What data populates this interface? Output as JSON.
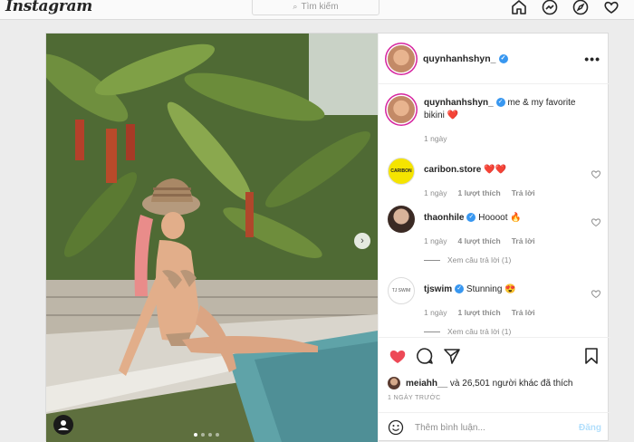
{
  "app": {
    "logo": "Instagram",
    "search_placeholder": "Tìm kiếm"
  },
  "post": {
    "author": "quynhanhshyn_",
    "caption": "me & my favorite bikini",
    "caption_emoji": "❤️",
    "caption_time": "1 ngày",
    "image_dots": 4,
    "active_dot": 0
  },
  "comments": [
    {
      "user": "caribon.store",
      "text": "❤️❤️",
      "verified": false,
      "time": "1 ngày",
      "likes": "1 lượt thích",
      "reply": "Trả lời",
      "view_replies": null
    },
    {
      "user": "thaonhile",
      "text": "Hoooot 🔥",
      "verified": true,
      "time": "1 ngày",
      "likes": "4 lượt thích",
      "reply": "Trả lời",
      "view_replies": "Xem câu trả lời (1)"
    },
    {
      "user": "tjswim",
      "text": "Stunning 😍",
      "verified": true,
      "time": "1 ngày",
      "likes": "1 lượt thích",
      "reply": "Trả lời",
      "view_replies": "Xem câu trả lời (1)"
    }
  ],
  "likes_line": {
    "user": "meiahh__",
    "rest": "và 26,501 người khác đã thích"
  },
  "post_time": "1 NGÀY TRƯỚC",
  "add_comment": {
    "placeholder": "Thêm bình luận...",
    "post_button": "Đăng"
  },
  "colors": {
    "like_red": "#ed4956",
    "verified_blue": "#3897f0",
    "post_button": "#b2dffc"
  }
}
